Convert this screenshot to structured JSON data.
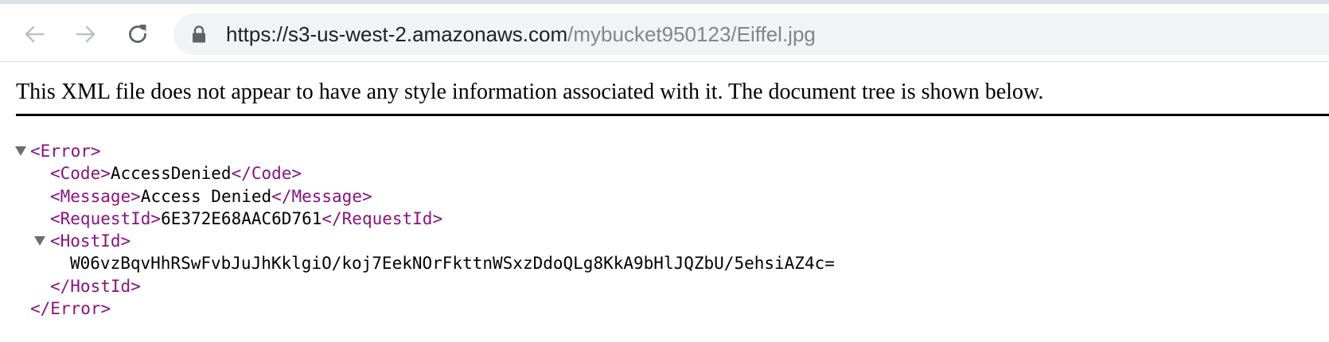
{
  "browser": {
    "url_host": "https://s3-us-west-2.amazonaws.com",
    "url_path": "/mybucket950123/Eiffel.jpg"
  },
  "page": {
    "notice": "This XML file does not appear to have any style information associated with it. The document tree is shown below."
  },
  "xml": {
    "error_open": "<Error>",
    "error_close": "</Error>",
    "code_open": "<Code>",
    "code_value": "AccessDenied",
    "code_close": "</Code>",
    "message_open": "<Message>",
    "message_value": "Access Denied",
    "message_close": "</Message>",
    "requestid_open": "<RequestId>",
    "requestid_value": "6E372E68AAC6D761",
    "requestid_close": "</RequestId>",
    "hostid_open": "<HostId>",
    "hostid_value": "W06vzBqvHhRSwFvbJuJhKklgiO/koj7EekNOrFkttnWSxzDdoQLg8KkA9bHlJQZbU/5ehsiAZ4c=",
    "hostid_close": "</HostId>"
  },
  "icons": {
    "back": "arrow-left-icon",
    "forward": "arrow-right-icon",
    "reload": "reload-icon",
    "lock": "lock-icon",
    "fold": "triangle-down-icon"
  },
  "colors": {
    "tag": "#881280",
    "nav_icon_disabled": "#bdc1c6",
    "nav_icon": "#5f6368",
    "omnibox_bg": "#f1f3f4",
    "url_path": "#80868b"
  }
}
